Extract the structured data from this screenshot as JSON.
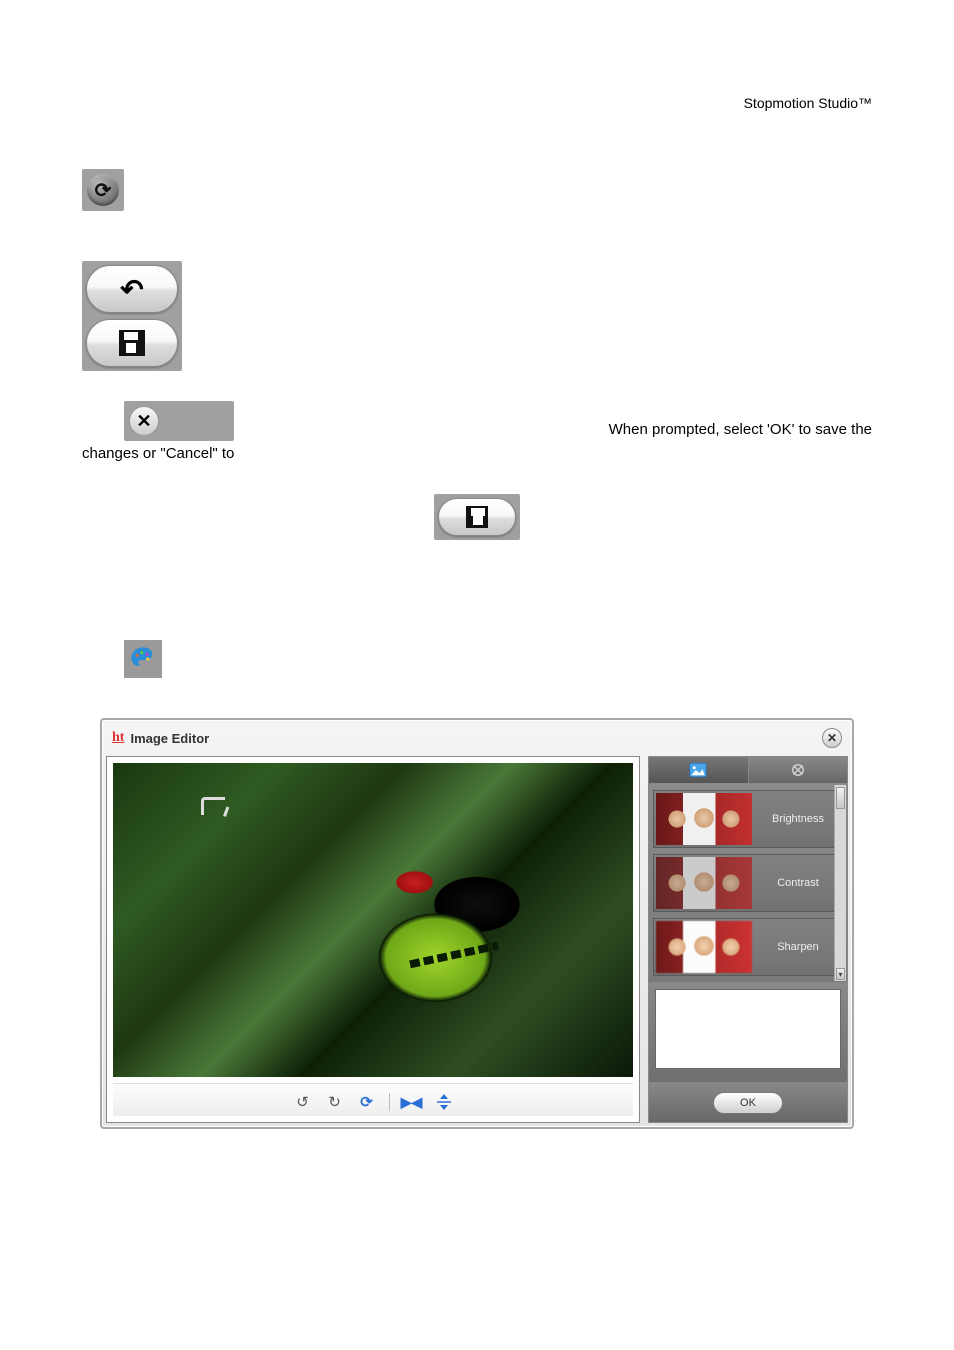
{
  "header": {
    "product": "Stopmotion Studio™"
  },
  "body_text": {
    "sentence_part1": "When prompted, select 'OK' to save the",
    "sentence_part2": "changes or \"Cancel\" to"
  },
  "editor": {
    "title": "Image Editor",
    "logo_text": "ht",
    "effects": [
      {
        "label": "Brightness"
      },
      {
        "label": "Contrast"
      },
      {
        "label": "Sharpen"
      }
    ],
    "ok_label": "OK"
  },
  "icons": {
    "zoom": "zoom-in-icon",
    "undo": "undo-icon",
    "save": "save-icon",
    "close": "close-icon",
    "palette": "palette-icon",
    "rotate_ccw": "rotate-ccw-icon",
    "rotate_cw": "rotate-cw-icon",
    "refresh": "refresh-icon",
    "flip_h": "flip-horizontal-icon",
    "flip_v": "flip-vertical-icon",
    "tab_image": "image-tab-icon",
    "tab_effects": "effects-tab-icon"
  }
}
